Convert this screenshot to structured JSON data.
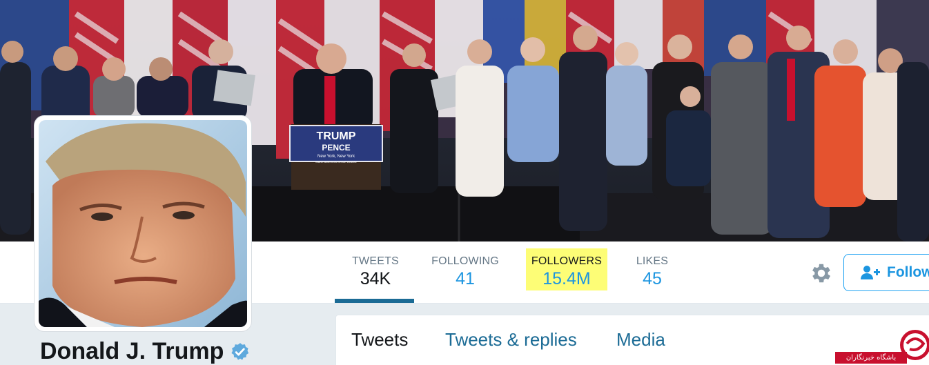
{
  "profile": {
    "name": "Donald J. Trump",
    "verified": true
  },
  "podium_sign": {
    "line1": "TRUMP",
    "line2": "PENCE",
    "line3": "New York, New York",
    "line4": "MAKE AMERICA GREAT AGAIN!"
  },
  "stats": [
    {
      "label": "TWEETS",
      "value": "34K"
    },
    {
      "label": "FOLLOWING",
      "value": "41"
    },
    {
      "label": "FOLLOWERS",
      "value": "15.4M"
    },
    {
      "label": "LIKES",
      "value": "45"
    }
  ],
  "actions": {
    "settings_icon": "gear-icon",
    "follow_label": "Follow",
    "follow_icon": "add-user-icon"
  },
  "tabs": [
    {
      "label": "Tweets"
    },
    {
      "label": "Tweets & replies"
    },
    {
      "label": "Media"
    }
  ],
  "colors": {
    "accent": "#1b95e0",
    "active_tab_underline": "#1b6b95",
    "highlight": "#fdfd76",
    "verified_badge": "#5ea9dd"
  },
  "watermark": {
    "text": "باشگاه خبرنگاران"
  }
}
